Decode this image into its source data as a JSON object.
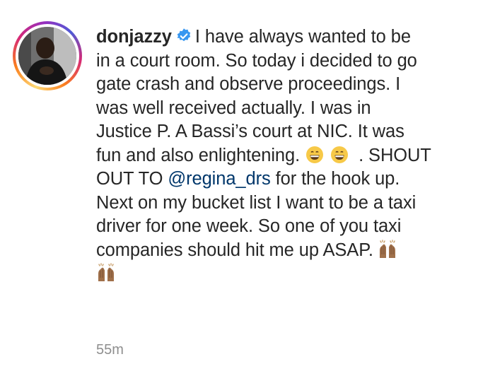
{
  "post": {
    "username": "donjazzy",
    "verified": true,
    "caption_lines": [
      "I have always wanted to be",
      "in a court room. So today i decided to go",
      "gate crash and observe proceedings. I",
      "was well received actually. I was in",
      "Justice P. A Bassi’s court at NIC. It was",
      "fun and also enlightening.",
      ". SHOUT",
      "OUT TO",
      "for the hook up.",
      "Next on my bucket list I want to be a taxi",
      "driver for one week. So one of you taxi",
      "companies should hit me up ASAP."
    ],
    "mention": "@regina_drs",
    "timestamp": "55m",
    "emoji": [
      "grinning-face-emoji",
      "grinning-face-emoji",
      "raising-hands-emoji",
      "raising-hands-emoji"
    ]
  },
  "colors": {
    "text": "#262626",
    "mention": "#00376b",
    "verified": "#3897f0",
    "timestamp": "#8e8e8e"
  }
}
